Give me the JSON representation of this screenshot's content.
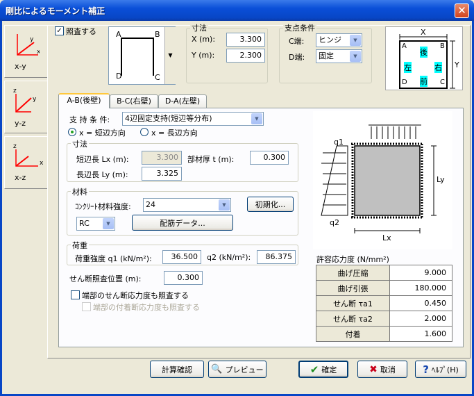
{
  "window": {
    "title": "剛比によるモーメント補正",
    "close_glyph": "✕"
  },
  "views": [
    {
      "label": "x-y",
      "x": "x",
      "y": "y"
    },
    {
      "label": "y-z",
      "x": "y",
      "y": "z"
    },
    {
      "label": "x-z",
      "x": "x",
      "y": "z"
    }
  ],
  "check_enable": {
    "label": "照査する",
    "checked": "✓"
  },
  "shape": {
    "a": "A",
    "b": "B",
    "c": "C",
    "d": "D"
  },
  "dims": {
    "title": "寸法",
    "x_label": "X (m):",
    "x_value": "3.300",
    "y_label": "Y (m):",
    "y_value": "2.300"
  },
  "support": {
    "title": "支点条件",
    "c_label": "C端:",
    "c_value": "ヒンジ",
    "d_label": "D端:",
    "d_value": "固定"
  },
  "plan": {
    "x": "X",
    "y": "Y",
    "a": "A",
    "b": "B",
    "c": "C",
    "d": "D",
    "back": "後",
    "left": "左",
    "right": "右",
    "front": "前"
  },
  "tabs": [
    "A-B(後壁)",
    "B-C(右壁)",
    "D-A(左壁)"
  ],
  "wall": {
    "support_label": "支 持 条 件:",
    "support_value": "4辺固定支持(短辺等分布)",
    "radio1": "x = 短辺方向",
    "radio2": "x = 長辺方向",
    "dim_title": "寸法",
    "lx_label": "短辺長 Lx (m):",
    "lx_value": "3.300",
    "t_label": "部材厚 t (m):",
    "t_value": "0.300",
    "ly_label": "長辺長 Ly (m):",
    "ly_value": "3.325",
    "mat_title": "材料",
    "conc_label": "ｺﾝｸﾘｰﾄ材料強度:",
    "conc_value": "24",
    "init_btn": "初期化...",
    "rc_value": "RC",
    "rebar_btn": "配筋データ...",
    "load_title": "荷重",
    "q1_label": "荷重強度 q1 (kN/m²):",
    "q1_value": "36.500",
    "q2_label": "q2 (kN/m²):",
    "q2_value": "86.375",
    "shear_label": "せん断照査位置 (m):",
    "shear_value": "0.300",
    "chk1": "端部のせん断応力度も照査する",
    "chk2": "端部の付着断応力度も照査する"
  },
  "diagram": {
    "q1": "q1",
    "q2": "q2",
    "ly": "Ly",
    "lx": "Lx"
  },
  "allow": {
    "title": "許容応力度 (N/mm²)",
    "rows": [
      [
        "曲げ圧縮",
        "9.000"
      ],
      [
        "曲げ引張",
        "180.000"
      ],
      [
        "せん断 τa1",
        "0.450"
      ],
      [
        "せん断 τa2",
        "2.000"
      ],
      [
        "付着",
        "1.600"
      ]
    ]
  },
  "buttons": {
    "calc": "計算確認",
    "preview": "プレビュー",
    "ok": "確定",
    "cancel": "取消",
    "help": "ﾍﾙﾌﾟ(H)"
  }
}
